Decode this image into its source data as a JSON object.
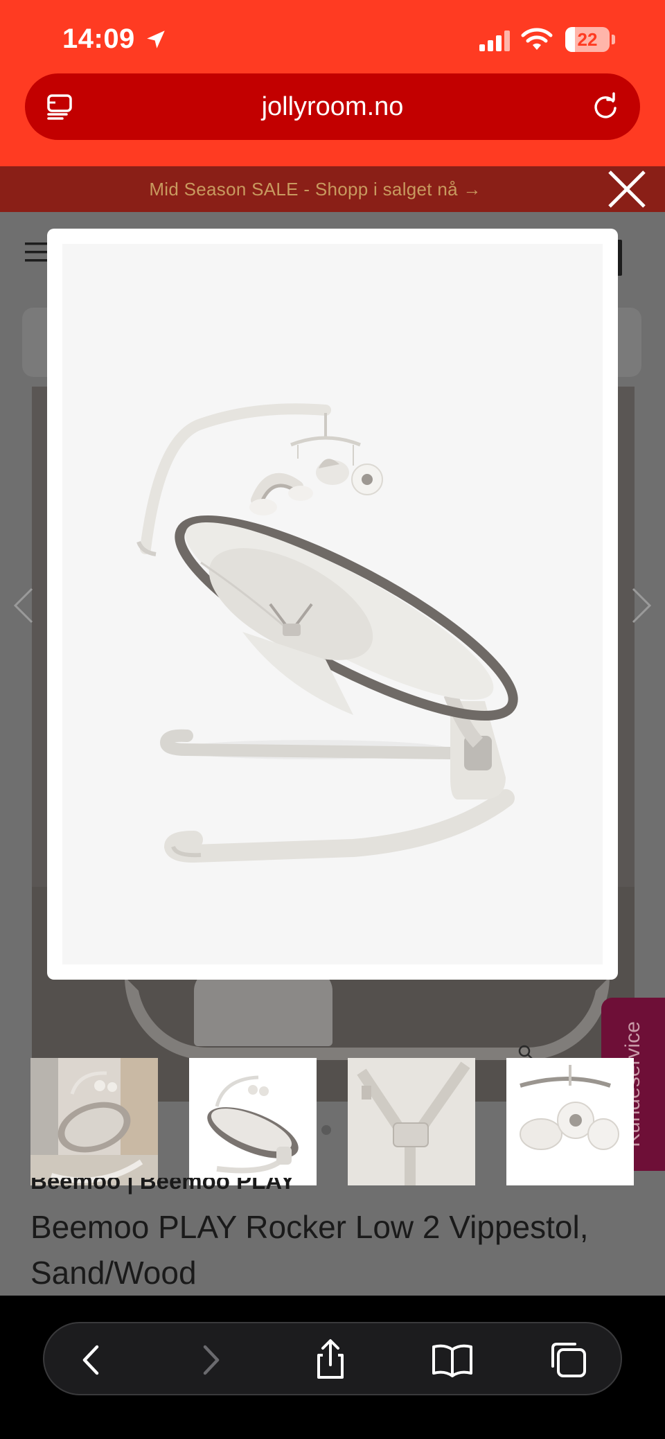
{
  "status_bar": {
    "time": "14:09",
    "battery_percent": "22",
    "battery_level": 0.22
  },
  "browser": {
    "url": "jollyroom.no",
    "icons": {
      "tabs": "tab-overview-icon",
      "reload": "reload-icon",
      "back": "chevron-left-icon",
      "forward": "chevron-right-icon",
      "share": "share-icon",
      "bookmarks": "book-icon",
      "tab_switcher": "tabs-icon"
    }
  },
  "page": {
    "promo_banner": "Mid Season SALE - Shopp i salget nå →",
    "side_tab": "Kundeservice",
    "brand_line": "Beemoo | Beemoo PLAY",
    "product_title": "Beemoo PLAY Rocker Low 2 Vippestol, Sand/Wood",
    "thumbnail_count": 4
  },
  "colors": {
    "brand_red": "#ff3b22",
    "url_bar": "#c20000",
    "promo_text": "#c89a5f",
    "side_tab": "#6e0f37"
  }
}
